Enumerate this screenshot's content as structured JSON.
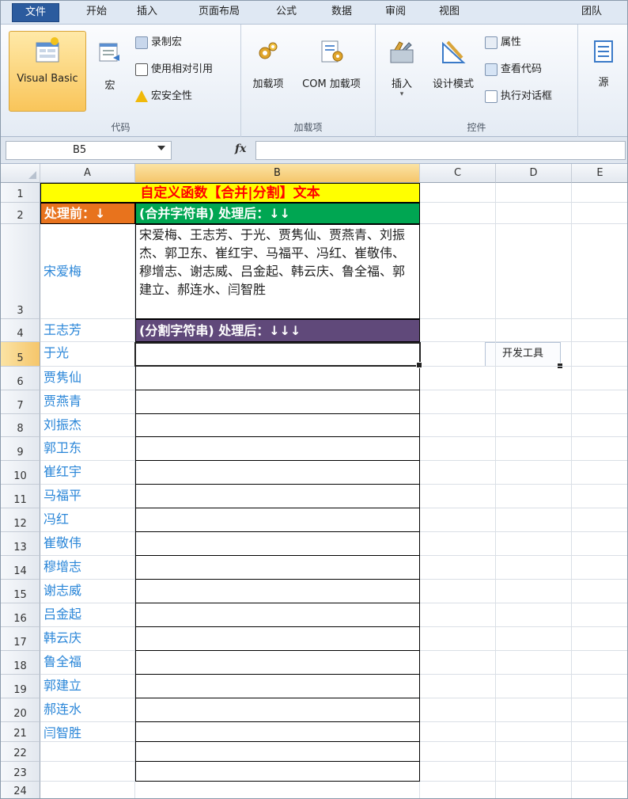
{
  "tabs": [
    {
      "label": "文件"
    },
    {
      "label": "开始"
    },
    {
      "label": "插入"
    },
    {
      "label": "页面布局"
    },
    {
      "label": "公式"
    },
    {
      "label": "数据"
    },
    {
      "label": "审阅"
    },
    {
      "label": "视图"
    },
    {
      "label": "开发工具"
    },
    {
      "label": "团队"
    }
  ],
  "ribbon": {
    "code": {
      "label": "代码",
      "visual_basic": "Visual Basic",
      "macro": "宏",
      "record_macro": "录制宏",
      "relative_ref": "使用相对引用",
      "macro_security": "宏安全性"
    },
    "addins": {
      "label": "加载项",
      "addins": "加载项",
      "com_addins": "COM 加载项"
    },
    "controls": {
      "label": "控件",
      "insert": "插入",
      "design_mode": "设计模式",
      "properties": "属性",
      "view_code": "查看代码",
      "run_dialog": "执行对话框"
    },
    "xml": {
      "source": "源"
    }
  },
  "formula_bar": {
    "name_box": "B5",
    "fx": "fx",
    "value": ""
  },
  "columns": [
    "A",
    "B",
    "C",
    "D",
    "E"
  ],
  "rows": [
    "1",
    "2",
    "3",
    "4",
    "5",
    "6",
    "7",
    "8",
    "9",
    "10",
    "11",
    "12",
    "13",
    "14",
    "15",
    "16",
    "17",
    "18",
    "19",
    "20",
    "21",
    "22",
    "23",
    "24"
  ],
  "sheet": {
    "title": "自定义函数【合并|分割】文本",
    "before_label": "处理前：↓",
    "merge_label": "(合并字符串) 处理后：↓↓",
    "merged_text": "宋爱梅、王志芳、于光、贾隽仙、贾燕青、刘振杰、郭卫东、崔红宇、马福平、冯红、崔敬伟、穆增志、谢志威、吕金起、韩云庆、鲁全福、郭建立、郝连水、闫智胜",
    "split_label": "(分割字符串) 处理后：↓↓↓",
    "names": [
      "宋爱梅",
      "王志芳",
      "于光",
      "贾隽仙",
      "贾燕青",
      "刘振杰",
      "郭卫东",
      "崔红宇",
      "马福平",
      "冯红",
      "崔敬伟",
      "穆增志",
      "谢志威",
      "吕金起",
      "韩云庆",
      "鲁全福",
      "郭建立",
      "郝连水",
      "闫智胜"
    ]
  }
}
